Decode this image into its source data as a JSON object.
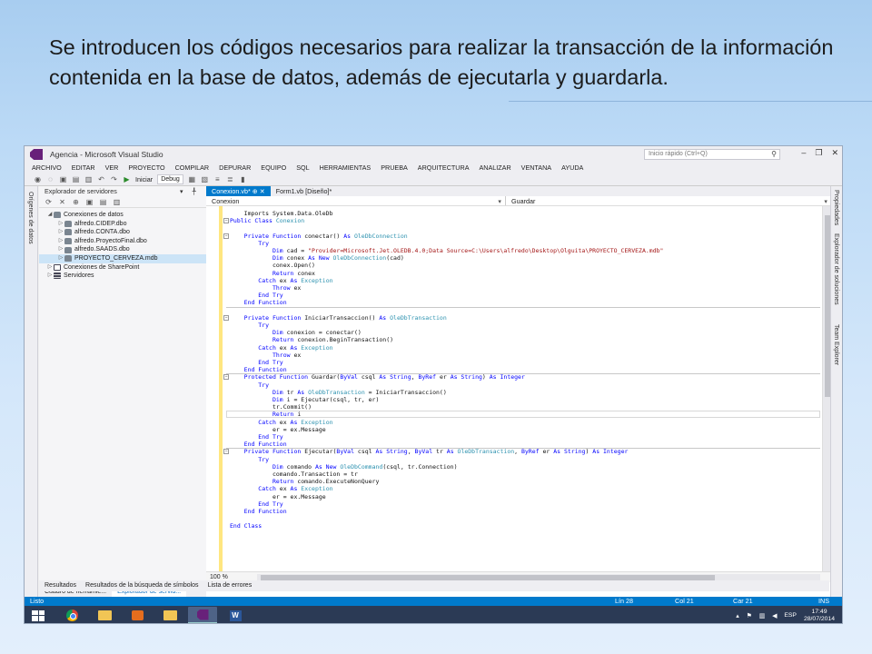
{
  "slide": {
    "title": "Se introducen los códigos necesarios para realizar la transacción de la información contenida en la base de datos, además de ejecutarla y guardarla."
  },
  "window": {
    "title": "Agencia - Microsoft Visual Studio",
    "quick_launch_placeholder": "Inicio rápido (Ctrl+Q)",
    "minimize": "–",
    "restore": "❐",
    "close": "✕"
  },
  "menu": [
    "ARCHIVO",
    "EDITAR",
    "VER",
    "PROYECTO",
    "COMPILAR",
    "DEPURAR",
    "EQUIPO",
    "SQL",
    "HERRAMIENTAS",
    "PRUEBA",
    "ARQUITECTURA",
    "ANALIZAR",
    "VENTANA",
    "AYUDA"
  ],
  "toolbar": {
    "start_label": "Iniciar",
    "config_value": "Debug"
  },
  "left_sidebar_tabs": [
    "Orígenes de datos"
  ],
  "right_sidebar_tabs": [
    "Propiedades",
    "Explorador de soluciones",
    "Team Explorer"
  ],
  "server_explorer": {
    "title": "Explorador de servidores",
    "pins": "▾ ╀ ✕",
    "tree": [
      {
        "label": "Conexiones de datos",
        "arrow": "◢",
        "indent": 0,
        "icon": "db",
        "selected": false
      },
      {
        "label": "alfredo.CIDEP.dbo",
        "arrow": "▷",
        "indent": 1,
        "icon": "db",
        "selected": false
      },
      {
        "label": "alfredo.CONTA.dbo",
        "arrow": "▷",
        "indent": 1,
        "icon": "db",
        "selected": false
      },
      {
        "label": "alfredo.ProyectoFinal.dbo",
        "arrow": "▷",
        "indent": 1,
        "icon": "db",
        "selected": false
      },
      {
        "label": "alfredo.SAADS.dbo",
        "arrow": "▷",
        "indent": 1,
        "icon": "db",
        "selected": false
      },
      {
        "label": "PROYECTO_CERVEZA.mdb",
        "arrow": "▷",
        "indent": 1,
        "icon": "db",
        "selected": true
      },
      {
        "label": "Conexiones de SharePoint",
        "arrow": "▷",
        "indent": 0,
        "icon": "sp",
        "selected": false
      },
      {
        "label": "Servidores",
        "arrow": "▷",
        "indent": 0,
        "icon": "srv",
        "selected": false
      }
    ],
    "bottom_tabs": [
      "Cuadro de herramie...",
      "Explorador de servid..."
    ]
  },
  "editor": {
    "tabs": [
      {
        "label": "Conexion.vb*  ⊕  ✕",
        "active": true
      },
      {
        "label": "Form1.vb [Diseño]*",
        "active": false
      }
    ],
    "nav_left": "Conexion",
    "nav_right": "Guardar",
    "zoom": "100 %"
  },
  "code": [
    {
      "t": [
        [
          "",
          "    Imports System.Data.OleDb"
        ]
      ]
    },
    {
      "t": [
        [
          "kw",
          "Public Class "
        ],
        [
          "ty",
          "Conexion"
        ]
      ]
    },
    {
      "t": [
        [
          "",
          ""
        ]
      ]
    },
    {
      "t": [
        [
          "kw",
          "    Private Function "
        ],
        [
          "",
          "conectar() "
        ],
        [
          "kw",
          "As "
        ],
        [
          "ty",
          "OleDbConnection"
        ]
      ]
    },
    {
      "t": [
        [
          "kw",
          "        Try"
        ]
      ]
    },
    {
      "t": [
        [
          "kw",
          "            Dim "
        ],
        [
          "",
          "cad = "
        ],
        [
          "st",
          "\"Provider=Microsoft.Jet.OLEDB.4.0;Data Source=C:\\Users\\alfredo\\Desktop\\Olguita\\PROYECTO_CERVEZA.mdb\""
        ]
      ]
    },
    {
      "t": [
        [
          "kw",
          "            Dim "
        ],
        [
          "",
          "conex "
        ],
        [
          "kw",
          "As New "
        ],
        [
          "ty",
          "OleDbConnection"
        ],
        [
          "",
          "(cad)"
        ]
      ]
    },
    {
      "t": [
        [
          "",
          "            conex.Open()"
        ]
      ]
    },
    {
      "t": [
        [
          "kw",
          "            Return "
        ],
        [
          "",
          "conex"
        ]
      ]
    },
    {
      "t": [
        [
          "kw",
          "        Catch "
        ],
        [
          "",
          "ex "
        ],
        [
          "kw",
          "As "
        ],
        [
          "ty",
          "Exception"
        ]
      ]
    },
    {
      "t": [
        [
          "kw",
          "            Throw "
        ],
        [
          "",
          "ex"
        ]
      ]
    },
    {
      "t": [
        [
          "kw",
          "        End Try"
        ]
      ]
    },
    {
      "t": [
        [
          "kw",
          "    End Function"
        ]
      ]
    },
    {
      "t": [
        [
          "",
          ""
        ]
      ]
    },
    {
      "t": [
        [
          "kw",
          "    Private Function "
        ],
        [
          "",
          "IniciarTransaccion() "
        ],
        [
          "kw",
          "As "
        ],
        [
          "ty",
          "OleDbTransaction"
        ]
      ]
    },
    {
      "t": [
        [
          "kw",
          "        Try"
        ]
      ]
    },
    {
      "t": [
        [
          "kw",
          "            Dim "
        ],
        [
          "",
          "conexion = conectar()"
        ]
      ]
    },
    {
      "t": [
        [
          "kw",
          "            Return "
        ],
        [
          "",
          "conexion.BeginTransaction()"
        ]
      ]
    },
    {
      "t": [
        [
          "kw",
          "        Catch "
        ],
        [
          "",
          "ex "
        ],
        [
          "kw",
          "As "
        ],
        [
          "ty",
          "Exception"
        ]
      ]
    },
    {
      "t": [
        [
          "kw",
          "            Throw "
        ],
        [
          "",
          "ex"
        ]
      ]
    },
    {
      "t": [
        [
          "kw",
          "        End Try"
        ]
      ]
    },
    {
      "t": [
        [
          "kw",
          "    End Function"
        ]
      ]
    },
    {
      "t": [
        [
          "kw",
          "    Protected Function "
        ],
        [
          "",
          "Guardar("
        ],
        [
          "kw",
          "ByVal "
        ],
        [
          "",
          "csql "
        ],
        [
          "kw",
          "As String"
        ],
        [
          "",
          ", "
        ],
        [
          "kw",
          "ByRef "
        ],
        [
          "",
          "er "
        ],
        [
          "kw",
          "As String"
        ],
        [
          "",
          ") "
        ],
        [
          "kw",
          "As Integer"
        ]
      ]
    },
    {
      "t": [
        [
          "kw",
          "        Try"
        ]
      ]
    },
    {
      "t": [
        [
          "kw",
          "            Dim "
        ],
        [
          "",
          "tr "
        ],
        [
          "kw",
          "As "
        ],
        [
          "ty",
          "OleDbTransaction"
        ],
        [
          "",
          " = IniciarTransaccion()"
        ]
      ]
    },
    {
      "t": [
        [
          "kw",
          "            Dim "
        ],
        [
          "",
          "i = Ejecutar(csql, tr, er)"
        ]
      ]
    },
    {
      "t": [
        [
          "",
          "            tr.Commit()"
        ]
      ]
    },
    {
      "t": [
        [
          "kw",
          "            Return "
        ],
        [
          "",
          "i"
        ]
      ]
    },
    {
      "t": [
        [
          "kw",
          "        Catch "
        ],
        [
          "",
          "ex "
        ],
        [
          "kw",
          "As "
        ],
        [
          "ty",
          "Exception"
        ]
      ]
    },
    {
      "t": [
        [
          "",
          "            er = ex.Message"
        ]
      ]
    },
    {
      "t": [
        [
          "kw",
          "        End Try"
        ]
      ]
    },
    {
      "t": [
        [
          "kw",
          "    End Function"
        ]
      ]
    },
    {
      "t": [
        [
          "kw",
          "    Private Function "
        ],
        [
          "",
          "Ejecutar("
        ],
        [
          "kw",
          "ByVal "
        ],
        [
          "",
          "csql "
        ],
        [
          "kw",
          "As String"
        ],
        [
          "",
          ", "
        ],
        [
          "kw",
          "ByVal "
        ],
        [
          "",
          "tr "
        ],
        [
          "kw",
          "As "
        ],
        [
          "ty",
          "OleDbTransaction"
        ],
        [
          "",
          ", "
        ],
        [
          "kw",
          "ByRef "
        ],
        [
          "",
          "er "
        ],
        [
          "kw",
          "As String"
        ],
        [
          "",
          ") "
        ],
        [
          "kw",
          "As Integer"
        ]
      ]
    },
    {
      "t": [
        [
          "kw",
          "        Try"
        ]
      ]
    },
    {
      "t": [
        [
          "kw",
          "            Dim "
        ],
        [
          "",
          "comando "
        ],
        [
          "kw",
          "As New "
        ],
        [
          "ty",
          "OleDbCommand"
        ],
        [
          "",
          "(csql, tr.Connection)"
        ]
      ]
    },
    {
      "t": [
        [
          "",
          "            comando.Transaction = tr"
        ]
      ]
    },
    {
      "t": [
        [
          "kw",
          "            Return "
        ],
        [
          "",
          "comando.ExecuteNonQuery"
        ]
      ]
    },
    {
      "t": [
        [
          "kw",
          "        Catch "
        ],
        [
          "",
          "ex "
        ],
        [
          "kw",
          "As "
        ],
        [
          "ty",
          "Exception"
        ]
      ]
    },
    {
      "t": [
        [
          "",
          "            er = ex.Message"
        ]
      ]
    },
    {
      "t": [
        [
          "kw",
          "        End Try"
        ]
      ]
    },
    {
      "t": [
        [
          "kw",
          "    End Function"
        ]
      ]
    },
    {
      "t": [
        [
          "",
          ""
        ]
      ]
    },
    {
      "t": [
        [
          "kw",
          "End Class"
        ]
      ]
    }
  ],
  "output_tabs": [
    "Resultados",
    "Resultados de la búsqueda de símbolos",
    "Lista de errores"
  ],
  "status": {
    "state": "Listo",
    "line": "Lín 28",
    "col": "Col 21",
    "car": "Car 21",
    "mode": "INS"
  },
  "taskbar": {
    "lang": "ESP",
    "time": "17:49",
    "date": "28/07/2014"
  },
  "colors": {
    "accent": "#007acc",
    "keyword": "#0000ff",
    "type": "#2b91af",
    "string": "#a31515"
  }
}
